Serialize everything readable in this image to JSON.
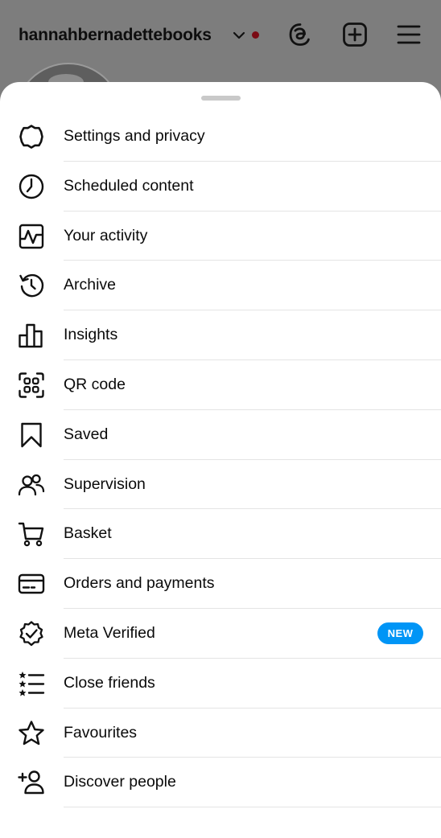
{
  "header": {
    "username": "hannahbernadettebooks",
    "icons": [
      "chevron-down-icon",
      "threads-icon",
      "create-plus-icon",
      "hamburger-menu-icon"
    ],
    "notification_dot_color": "#7a0a14"
  },
  "sheet": {
    "items": [
      {
        "label": "Settings and privacy",
        "icon": "settings-gear-icon"
      },
      {
        "label": "Scheduled content",
        "icon": "clock-icon"
      },
      {
        "label": "Your activity",
        "icon": "activity-icon"
      },
      {
        "label": "Archive",
        "icon": "archive-history-icon"
      },
      {
        "label": "Insights",
        "icon": "bar-chart-icon"
      },
      {
        "label": "QR code",
        "icon": "qr-code-icon"
      },
      {
        "label": "Saved",
        "icon": "bookmark-icon"
      },
      {
        "label": "Supervision",
        "icon": "people-icon"
      },
      {
        "label": "Basket",
        "icon": "cart-icon"
      },
      {
        "label": "Orders and payments",
        "icon": "card-icon"
      },
      {
        "label": "Meta Verified",
        "icon": "verified-badge-icon",
        "badge": "NEW"
      },
      {
        "label": "Close friends",
        "icon": "star-list-icon"
      },
      {
        "label": "Favourites",
        "icon": "star-icon"
      },
      {
        "label": "Discover people",
        "icon": "add-person-icon"
      }
    ]
  },
  "colors": {
    "accent": "#0095f6",
    "overlay": "#7d7d7d"
  }
}
